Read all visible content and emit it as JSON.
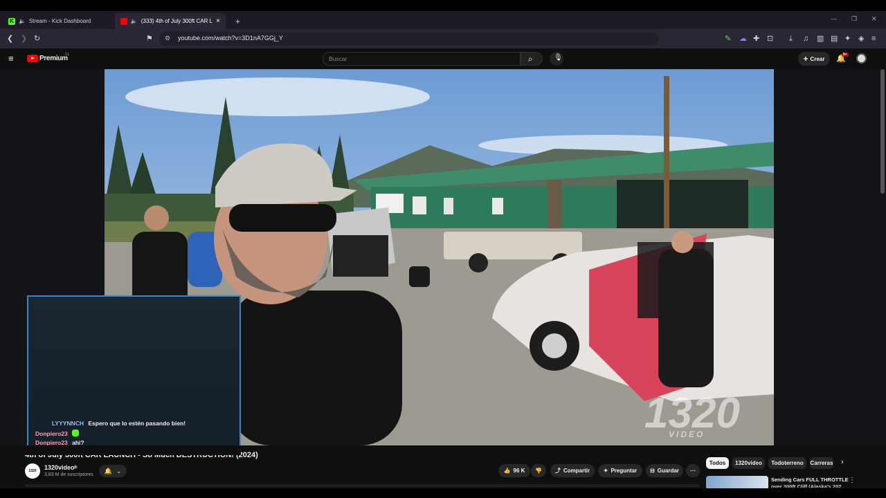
{
  "browser": {
    "tabs": [
      {
        "label": "Stream - Kick Dashboard",
        "active": false
      },
      {
        "label": "(333) 4th of July 300ft CAR LA",
        "active": true
      }
    ],
    "new_tab": "+",
    "url": "youtube.com/watch?v=3D1nA7GGj_Y",
    "badge_count": "9+"
  },
  "youtube": {
    "logo_text": "Premium",
    "logo_region": "CL",
    "search_placeholder": "Buscar",
    "create_label": "Crear",
    "notif_count": "9+"
  },
  "chat": {
    "messages": [
      {
        "user": "LYYYNNCH",
        "text": "Espero que lo estén pasando bien!"
      },
      {
        "user": "Donpiero23",
        "text": ""
      },
      {
        "user": "Donpiero23",
        "text": "ahi?"
      }
    ]
  },
  "video": {
    "title": "4th of July 300ft CAR LAUNCH - So Much DESTRUCTION! (2024)",
    "watermark": "1320",
    "watermark_sub": "VIDEO",
    "channel": "1320video",
    "subscribers": "3,83 M de suscriptores",
    "likes": "96 K",
    "share_label": "Compartir",
    "ask_label": "Preguntar",
    "save_label": "Guardar"
  },
  "chips": [
    {
      "label": "Todos",
      "selected": true
    },
    {
      "label": "1320video",
      "selected": false
    },
    {
      "label": "Todoterreno",
      "selected": false
    },
    {
      "label": "Carreras",
      "selected": false
    }
  ],
  "recommendation": {
    "title": "Sending Cars FULL THROTTLE",
    "subtitle": "over 300ft Cliff (Alaska's 202..."
  },
  "colors": {
    "youtube_red": "#ff0000",
    "kick_green": "#53fc18",
    "chat_border": "#3a86c8"
  }
}
